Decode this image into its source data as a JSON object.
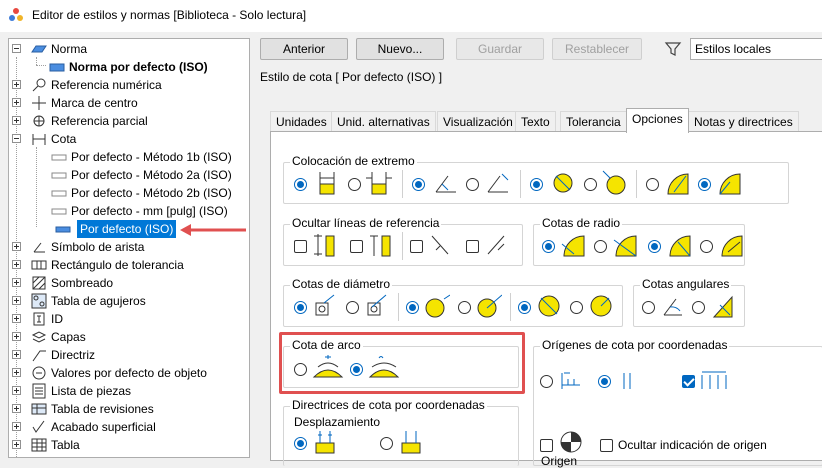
{
  "window": {
    "title": "Editor de estilos y normas [Biblioteca - Solo lectura]"
  },
  "tree": {
    "items": [
      {
        "label": "Norma"
      },
      {
        "label": "Norma por defecto (ISO)"
      },
      {
        "label": "Referencia numérica"
      },
      {
        "label": "Marca de centro"
      },
      {
        "label": "Referencia parcial"
      },
      {
        "label": "Cota"
      },
      {
        "label": "Por defecto - Método 1b (ISO)"
      },
      {
        "label": "Por defecto - Método 2a (ISO)"
      },
      {
        "label": "Por defecto - Método 2b (ISO)"
      },
      {
        "label": "Por defecto - mm [pulg] (ISO)"
      },
      {
        "label": "Por defecto (ISO)"
      },
      {
        "label": "Símbolo de arista"
      },
      {
        "label": "Rectángulo de tolerancia"
      },
      {
        "label": "Sombreado"
      },
      {
        "label": "Tabla de agujeros"
      },
      {
        "label": "ID"
      },
      {
        "label": "Capas"
      },
      {
        "label": "Directriz"
      },
      {
        "label": "Valores por defecto de objeto"
      },
      {
        "label": "Lista de piezas"
      },
      {
        "label": "Tabla de revisiones"
      },
      {
        "label": "Acabado superficial"
      },
      {
        "label": "Tabla"
      }
    ]
  },
  "toolbar": {
    "back_label": "Anterior",
    "new_label": "Nuevo...",
    "save_label": "Guardar",
    "reset_label": "Restablecer",
    "filter_value": "Estilos locales"
  },
  "style_title": "Estilo de cota [ Por defecto (ISO) ]",
  "tabs": [
    {
      "label": "Unidades"
    },
    {
      "label": "Unid. alternativas"
    },
    {
      "label": "Visualización"
    },
    {
      "label": "Texto"
    },
    {
      "label": "Tolerancia"
    },
    {
      "label": "Opciones"
    },
    {
      "label": "Notas y directrices"
    }
  ],
  "groups": {
    "terminator": "Colocación de extremo",
    "hide_ext": "Ocultar líneas de referencia",
    "radius": "Cotas de radio",
    "diameter": "Cotas de diámetro",
    "angular": "Cotas angulares",
    "arc": "Cota de arco",
    "ordinate_origin": "Orígenes de cota por coordenadas",
    "ordinate_leaders": "Directrices de cota por coordenadas",
    "offset": "Desplazamiento",
    "hide_origin": "Ocultar indicación de origen",
    "origin_partial": "Origen"
  },
  "colors": {
    "accent": "#0067c0",
    "selection": "#0078d7",
    "highlight": "#e05050",
    "icon_fill": "#f5e400"
  }
}
